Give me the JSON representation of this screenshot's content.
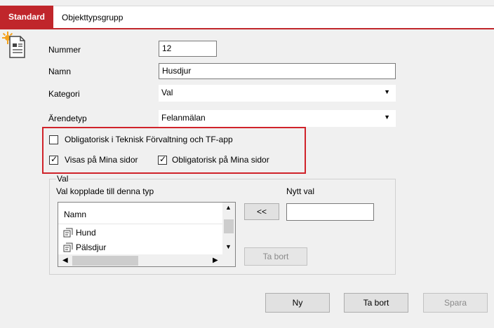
{
  "tabs": [
    {
      "label": "Standard",
      "active": true
    },
    {
      "label": "Objekttypsgrupp",
      "active": false
    }
  ],
  "form": {
    "nummer_label": "Nummer",
    "nummer_value": "12",
    "namn_label": "Namn",
    "namn_value": "Husdjur",
    "kategori_label": "Kategori",
    "kategori_value": "Val",
    "arendetyp_label": "Ärendetyp",
    "arendetyp_value": "Felanmälan"
  },
  "checkboxes": [
    {
      "label": "Obligatorisk i Teknisk Förvaltning och TF-app",
      "checked": false
    },
    {
      "label": "Visas på Mina sidor",
      "checked": true
    },
    {
      "label": "Obligatorisk på Mina sidor",
      "checked": true
    }
  ],
  "val_group": {
    "title": "Val",
    "linked_label": "Val kopplade till denna typ",
    "new_label": "Nytt val",
    "new_value": "",
    "list_header": "Namn",
    "items": [
      "Hund",
      "Pälsdjur"
    ],
    "add_button": "<<",
    "remove_button": "Ta bort"
  },
  "footer": {
    "new_button": "Ny",
    "delete_button": "Ta bort",
    "save_button": "Spara"
  },
  "colors": {
    "accent": "#c0262b",
    "highlight": "#d0232a"
  }
}
